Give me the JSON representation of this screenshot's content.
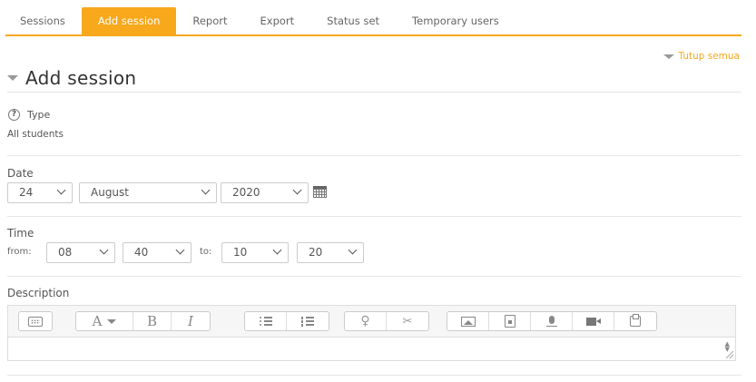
{
  "tabs": [
    {
      "label": "Sessions"
    },
    {
      "label": "Add session",
      "active": true
    },
    {
      "label": "Report"
    },
    {
      "label": "Export"
    },
    {
      "label": "Status set"
    },
    {
      "label": "Temporary users"
    }
  ],
  "collapse_all": "Tutup semua",
  "section": {
    "title": "Add session"
  },
  "type": {
    "label": "Type",
    "value": "All students",
    "help_icon": "question-circle-icon"
  },
  "date": {
    "label": "Date",
    "day": "24",
    "month": "August",
    "year": "2020",
    "calendar_icon": "calendar-icon"
  },
  "time": {
    "label": "Time",
    "from_label": "from:",
    "to_label": "to:",
    "from_hour": "08",
    "from_minute": "40",
    "to_hour": "10",
    "to_minute": "20"
  },
  "description": {
    "label": "Description",
    "font_button": "A",
    "bold": "B",
    "italic": "I",
    "value": ""
  },
  "colors": {
    "accent": "#f7a81b"
  }
}
